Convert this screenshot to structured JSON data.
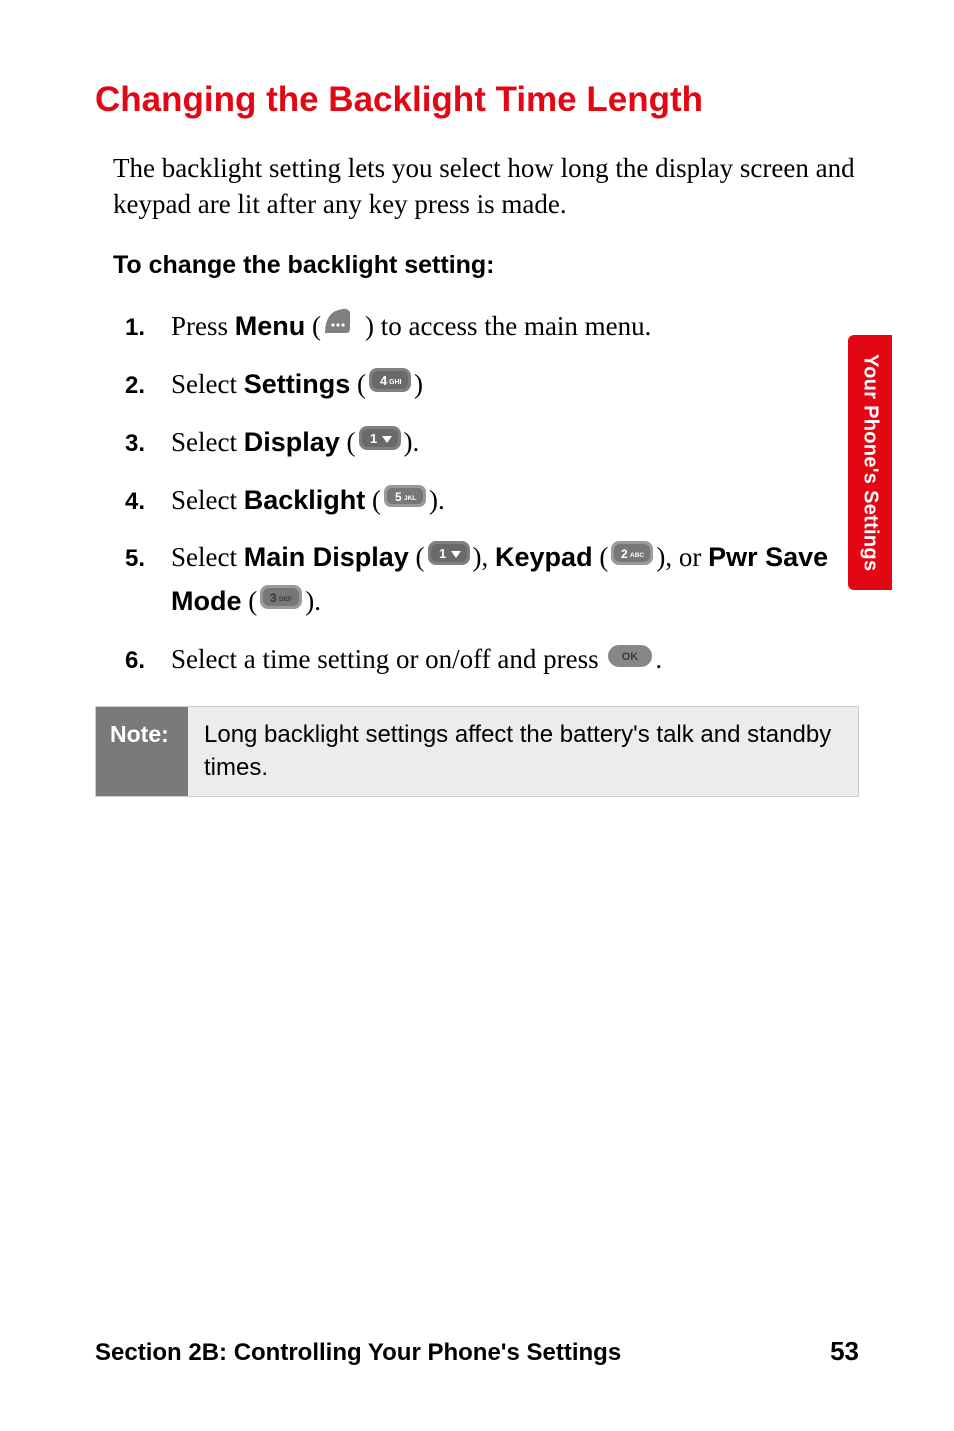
{
  "heading": "Changing the Backlight Time Length",
  "intro": "The backlight setting lets you select how long the display screen and keypad are lit after any key press is made.",
  "subhead": "To change the backlight setting:",
  "steps": {
    "s1": {
      "num": "1.",
      "t_press": "Press ",
      "t_menu": "Menu",
      "t_open": " (",
      "t_close": ") to access the main menu."
    },
    "s2": {
      "num": "2.",
      "t_select": "Select ",
      "t_settings": "Settings",
      "t_open": " (",
      "t_close": ")"
    },
    "s3": {
      "num": "3.",
      "t_select": "Select ",
      "t_display": "Display",
      "t_open": " (",
      "t_close": ")."
    },
    "s4": {
      "num": "4.",
      "t_select": "Select ",
      "t_backlight": "Backlight",
      "t_open": " (",
      "t_close": ")."
    },
    "s5": {
      "num": "5.",
      "t_select": "Select ",
      "t_main": "Main Display",
      "t_o1": " (",
      "t_c1": "), ",
      "t_keypad": "Keypad",
      "t_o2": " (",
      "t_c2": "), or ",
      "t_pwr": "Pwr Save Mode",
      "t_o3": " (",
      "t_c3": ")."
    },
    "s6": {
      "num": "6.",
      "t1": "Select a time setting or on/off and press ",
      "t2": "."
    }
  },
  "note": {
    "label": "Note:",
    "text": "Long backlight settings affect the battery's talk and standby times."
  },
  "side_tab": "Your Phone's Settings",
  "footer": {
    "section": "Section 2B: Controlling Your Phone's Settings",
    "page": "53"
  },
  "keys": {
    "menu": "…",
    "k4": "4 GHI",
    "k1": "1",
    "k5": "5 JKL",
    "k2": "2 ABC",
    "k3": "3 DEF",
    "ok": "OK"
  }
}
